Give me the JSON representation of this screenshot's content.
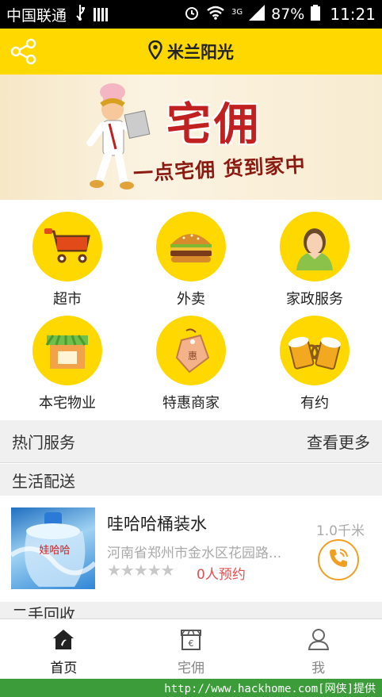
{
  "status_bar": {
    "carrier": "中国联通",
    "network": "3G",
    "battery": "87%",
    "time": "11:21"
  },
  "header": {
    "location": "米兰阳光",
    "location_icon": "map-pin-icon",
    "share_icon": "share-icon"
  },
  "banner": {
    "title": "宅佣",
    "slogan": "一点宅佣 货到家中"
  },
  "categories": [
    {
      "label": "超市",
      "icon": "shopping-cart-icon"
    },
    {
      "label": "外卖",
      "icon": "burger-icon"
    },
    {
      "label": "家政服务",
      "icon": "housekeeper-icon"
    },
    {
      "label": "本宅物业",
      "icon": "storefront-icon"
    },
    {
      "label": "特惠商家",
      "icon": "discount-tag-icon"
    },
    {
      "label": "有约",
      "icon": "beer-mugs-icon"
    }
  ],
  "hot_services": {
    "title": "热门服务",
    "more": "查看更多"
  },
  "section_life": "生活配送",
  "listing": {
    "name": "哇哈哈桶装水",
    "address": "河南省郑州市金水区花园路...",
    "rating_stars": "★★★★★",
    "booked": "0人预约",
    "distance": "1.0千米",
    "thumb_text": "娃哈哈"
  },
  "section_second": "二手回收",
  "tabs": [
    {
      "label": "首页",
      "icon": "home-icon"
    },
    {
      "label": "宅佣",
      "icon": "store-euro-icon"
    },
    {
      "label": "我",
      "icon": "user-icon"
    }
  ],
  "footer_text": "http://www.hackhome.com[网侠]提供",
  "colors": {
    "accent": "#ffd800",
    "call_ring": "#f0a020",
    "booked": "#e05050",
    "footer": "#3c9c3a"
  }
}
